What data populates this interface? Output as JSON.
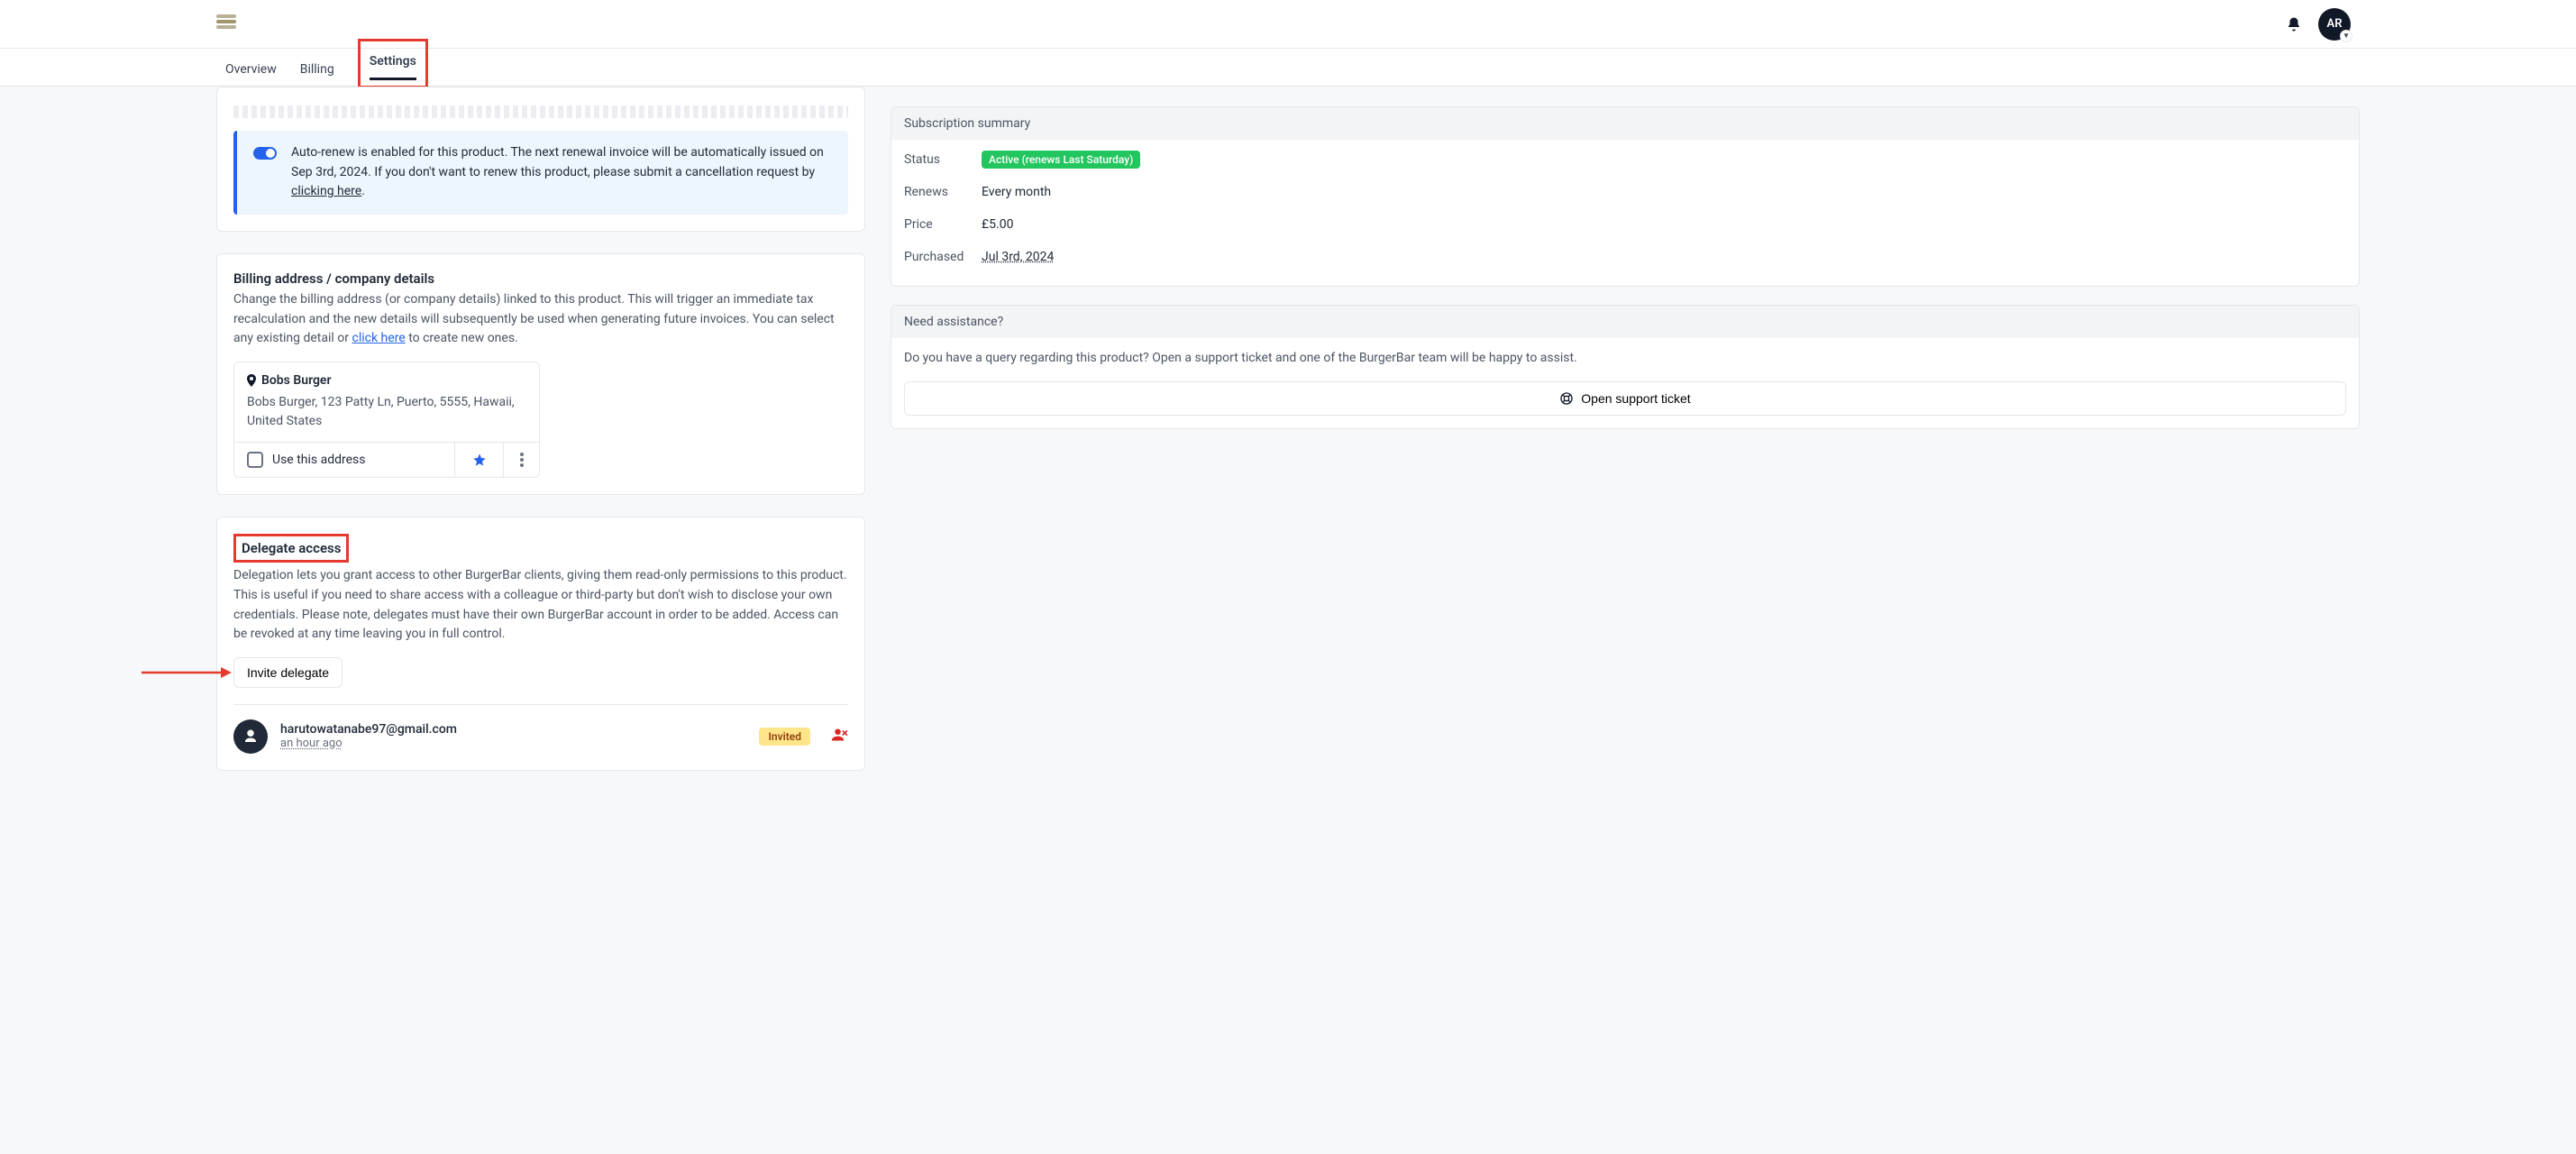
{
  "header": {
    "avatar_initials": "AR"
  },
  "tabs": {
    "overview": "Overview",
    "billing": "Billing",
    "settings": "Settings"
  },
  "autorenew": {
    "text_pre": "Auto-renew is enabled for this product. The next renewal invoice will be automatically issued on Sep 3rd, 2024. If you don't want to renew this product, please submit a cancellation request by ",
    "link": "clicking here",
    "text_post": "."
  },
  "billing_address": {
    "title": "Billing address / company details",
    "desc_pre": "Change the billing address (or company details) linked to this product. This will trigger an immediate tax recalculation and the new details will subsequently be used when generating future invoices. You can select any existing detail or ",
    "desc_link": "click here",
    "desc_post": " to create new ones.",
    "card": {
      "name": "Bobs Burger",
      "line": "Bobs Burger, 123 Patty Ln, Puerto, 5555, Hawaii, United States",
      "use_label": "Use this address"
    }
  },
  "delegate": {
    "title": "Delegate access",
    "desc": "Delegation lets you grant access to other BurgerBar clients, giving them read-only permissions to this product. This is useful if you need to share access with a colleague or third-party but don't wish to disclose your own credentials. Please note, delegates must have their own BurgerBar account in order to be added. Access can be revoked at any time leaving you in full control.",
    "invite_label": "Invite delegate",
    "item": {
      "email": "harutowatanabe97@gmail.com",
      "time": "an hour ago",
      "badge": "Invited"
    }
  },
  "summary": {
    "head": "Subscription summary",
    "status_label": "Status",
    "status_badge": "Active (renews Last Saturday)",
    "renews_label": "Renews",
    "renews_value": "Every month",
    "price_label": "Price",
    "price_value": "£5.00",
    "purchased_label": "Purchased",
    "purchased_value": "Jul 3rd, 2024"
  },
  "assist": {
    "head": "Need assistance?",
    "text": "Do you have a query regarding this product? Open a support ticket and one of the BurgerBar team will be happy to assist.",
    "button": "Open support ticket"
  }
}
